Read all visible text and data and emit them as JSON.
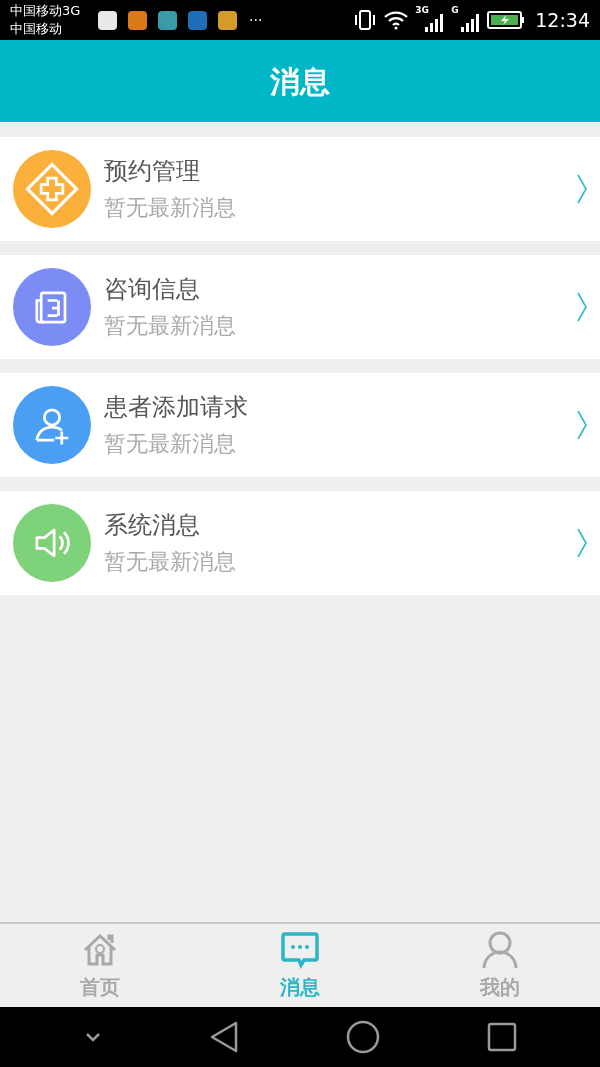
{
  "status_bar": {
    "carriers": [
      "中国移动3G",
      "中国移动"
    ],
    "more": "···",
    "network_1": "3G",
    "network_2": "G",
    "time": "12:34"
  },
  "header": {
    "title": "消息"
  },
  "messages": [
    {
      "kind": "appointment",
      "color": "#fbb03b",
      "title": "预约管理",
      "subtitle": "暂无最新消息"
    },
    {
      "kind": "consult",
      "color": "#7b8cf5",
      "title": "咨询信息",
      "subtitle": "暂无最新消息"
    },
    {
      "kind": "patient",
      "color": "#4a9ff5",
      "title": "患者添加请求",
      "subtitle": "暂无最新消息"
    },
    {
      "kind": "system",
      "color": "#7dd27a",
      "title": "系统消息",
      "subtitle": "暂无最新消息"
    }
  ],
  "tab_bar": [
    {
      "kind": "home",
      "label": "首页",
      "selected": false
    },
    {
      "kind": "messages",
      "label": "消息",
      "selected": true
    },
    {
      "kind": "profile",
      "label": "我的",
      "selected": false
    }
  ]
}
